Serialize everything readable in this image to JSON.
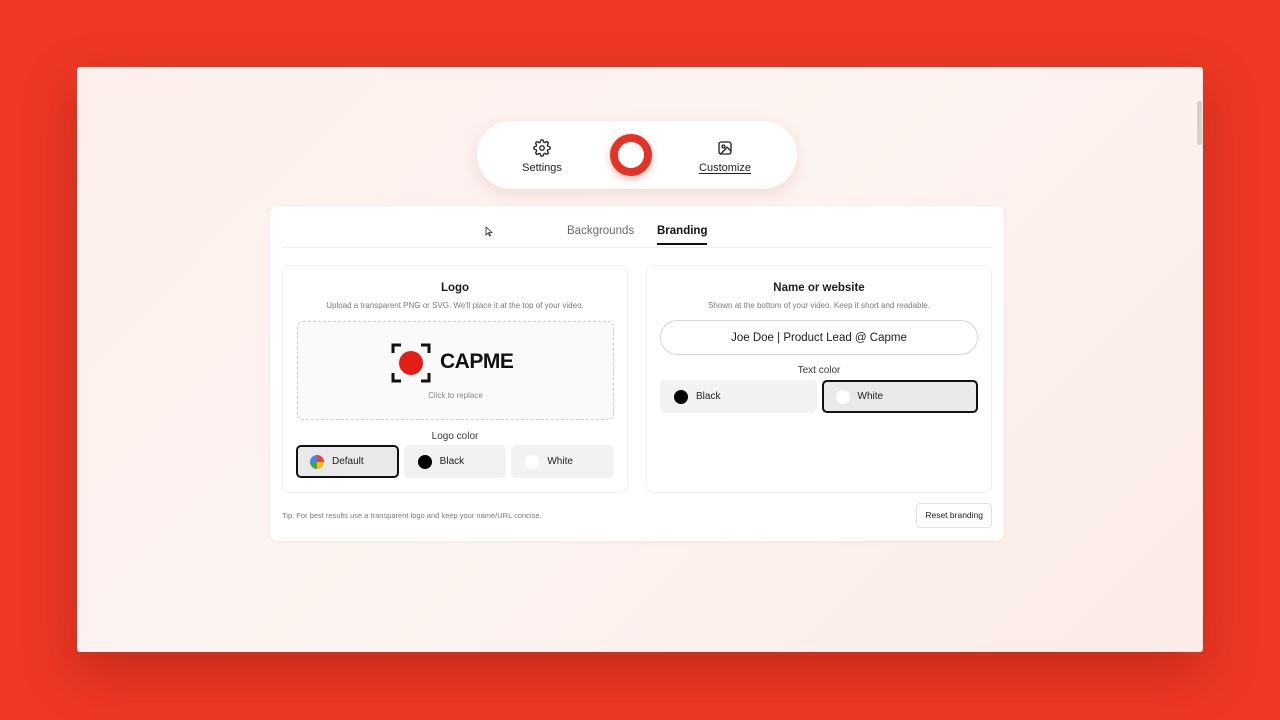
{
  "toolbar": {
    "settings_label": "Settings",
    "customize_label": "Customize"
  },
  "tabs": [
    {
      "label": "Backgrounds",
      "active": false
    },
    {
      "label": "Branding",
      "active": true
    }
  ],
  "logo_card": {
    "title": "Logo",
    "subtitle": "Upload a transparent PNG or SVG. We'll place it at the top of your video.",
    "logo_text": "CAPME",
    "dropzone_hint": "Click to replace",
    "color_label": "Logo color",
    "options": [
      {
        "label": "Default",
        "swatch": "multicolor",
        "selected": true
      },
      {
        "label": "Black",
        "swatch": "#000000",
        "selected": false
      },
      {
        "label": "White",
        "swatch": "#ffffff",
        "selected": false
      }
    ]
  },
  "name_card": {
    "title": "Name or website",
    "subtitle": "Shown at the bottom of your video. Keep it short and readable.",
    "input_value": "Joe Doe | Product Lead @ Capme",
    "color_label": "Text color",
    "options": [
      {
        "label": "Black",
        "swatch": "#000000",
        "selected": false
      },
      {
        "label": "White",
        "swatch": "#ffffff",
        "selected": true
      }
    ]
  },
  "footer": {
    "tip": "Tip: For best results use a transparent logo and keep your name/URL concise.",
    "reset_label": "Reset branding"
  },
  "colors": {
    "background": "#ee3824",
    "accent": "#e33326"
  }
}
